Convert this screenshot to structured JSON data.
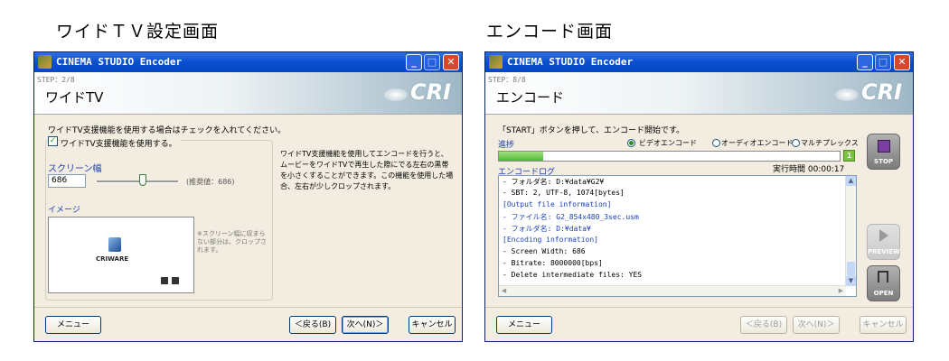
{
  "captions": {
    "left": "ワイドＴＶ設定画面",
    "right": "エンコード画面"
  },
  "app_title": "CINEMA STUDIO Encoder",
  "logo_text": "CRI",
  "left_window": {
    "step": "STEP：2/8",
    "title": "ワイドTV",
    "instruction": "ワイドTV支援機能を使用する場合はチェックを入れてください。",
    "checkbox_label": "ワイドTV支援機能を使用する。",
    "checkbox_checked": true,
    "screen_width_label": "スクリーン幅",
    "screen_width_value": "686",
    "recommended": "(推奨値：686)",
    "image_label": "イメージ",
    "preview_logo": "CRIWARE",
    "preview_note": [
      "※スクリーン幅に収まら",
      "ない部分は、クロップさ",
      "れます。"
    ],
    "description": [
      "ワイドTV支援機能を使用してエンコードを行うと、",
      "ムービーをワイドTVで再生した際にでる左右の黒帯",
      "を小さくすることができます。この機能を使用した場",
      "合、左右が少しクロップされます。"
    ],
    "buttons": {
      "menu": "メニュー",
      "back": "＜戻る(B)",
      "next": "次へ(N)＞",
      "cancel": "キャンセル"
    }
  },
  "right_window": {
    "step": "STEP：8/8",
    "title": "エンコード",
    "instruction": "「START」ボタンを押して、エンコード開始です。",
    "progress_label": "進捗",
    "radio_video": "ビデオエンコード",
    "radio_audio": "オーディオエンコード",
    "radio_mux": "マルチプレックス",
    "progress_fraction": 0.13,
    "counter": "1",
    "log_label": "エンコードログ",
    "elapsed": "実行時間 00:00:17",
    "log_lines": [
      " -   フォルダ名: D:¥data¥G2¥",
      " - SBT: 2, UTF-8, 1074[bytes]",
      "[Output file information]",
      " -   ファイル名: G2_854x480_3sec.usm",
      " -   フォルダ名: D:¥data¥",
      "[Encoding information]",
      " - Screen Width: 686",
      " - Bitrate: 8000000[bps]",
      " - Delete intermediate files: YES"
    ],
    "side_buttons": {
      "stop": "STOP",
      "preview": "PREVIEW",
      "open": "OPEN"
    },
    "buttons": {
      "menu": "メニュー",
      "back": "＜戻る(B)",
      "next": "次へ(N)＞",
      "cancel": "キャンセル"
    }
  },
  "colors": {
    "titlebar": "#0a4ed1",
    "progress": "#52b83a",
    "log_blue": "#1b3fb5"
  }
}
